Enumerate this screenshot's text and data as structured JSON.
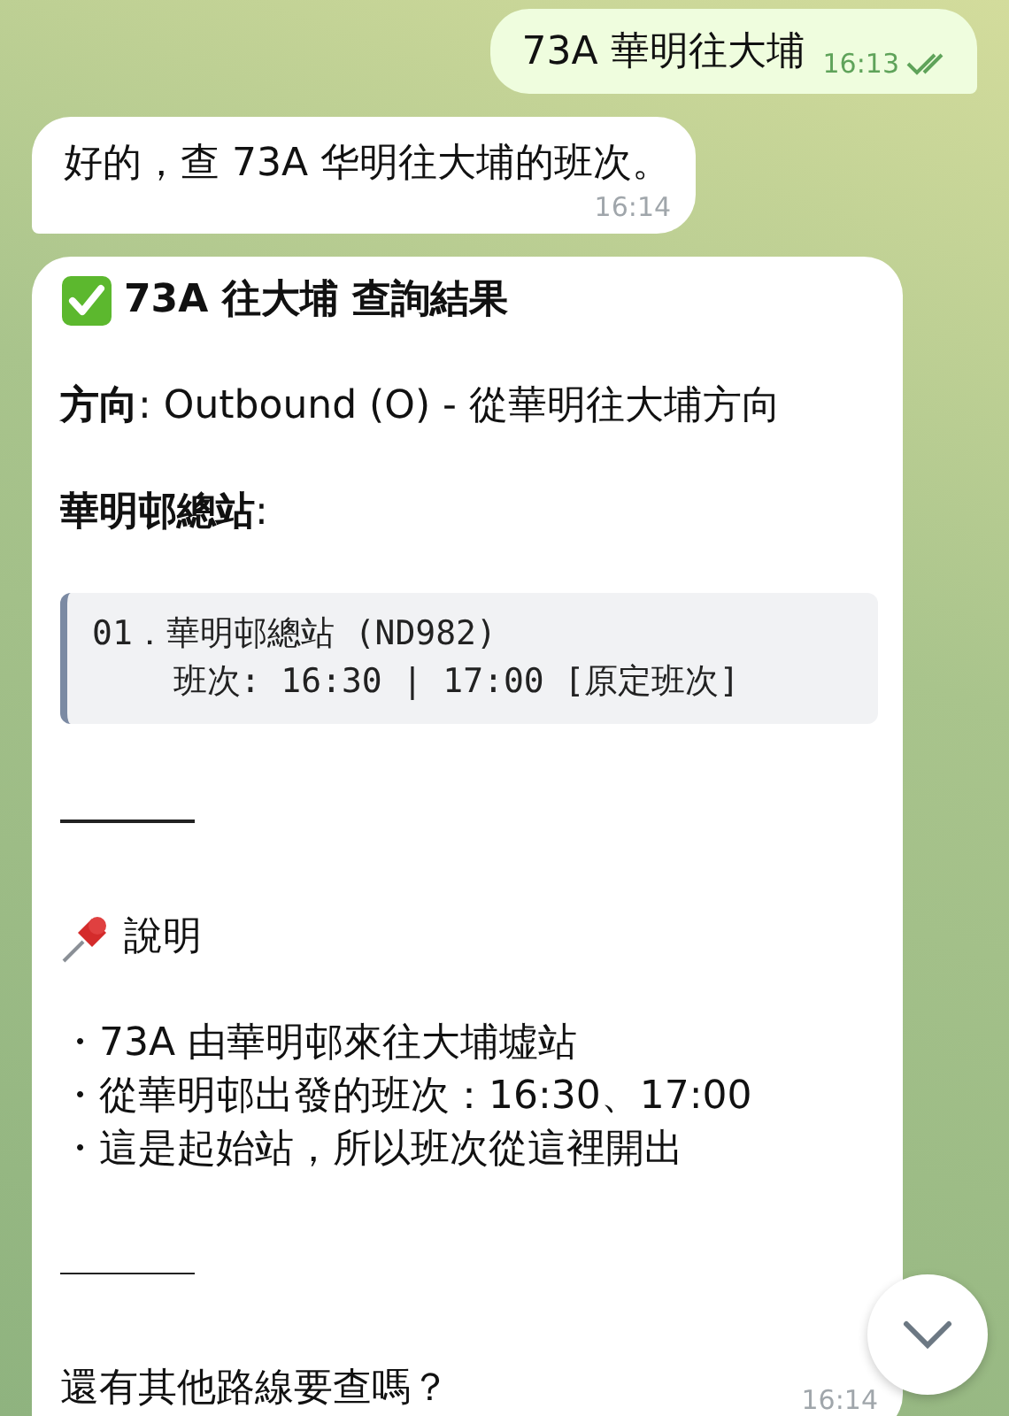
{
  "messages": [
    {
      "kind": "outgoing",
      "text": "73A 華明往大埔",
      "time": "16:13",
      "read": true
    },
    {
      "kind": "incoming",
      "text": "好的，查 73A 华明往大埔的班次。",
      "time": "16:14"
    },
    {
      "kind": "rich",
      "time": "16:14",
      "blocks": [
        {
          "kind": "title",
          "text": "73A 往大埔 查詢結果"
        },
        {
          "kind": "paragraph",
          "text": "**方向**: Outbound (O) - 從華明往大埔方向"
        },
        {
          "kind": "paragraph",
          "text": "**華明邨總站**:"
        },
        {
          "kind": "code",
          "lines": [
            "01．華明邨總站 (ND982)",
            "    班次: 16:30 | 17:00 [原定班次]"
          ]
        },
        {
          "kind": "rule"
        },
        {
          "kind": "section",
          "text": "說明"
        },
        {
          "kind": "bullets",
          "items": [
            "・73A 由華明邨來往大埔墟站",
            "・從華明邨出發的班次：16:30、17:00",
            "・這是起始站，所以班次從這裡開出"
          ]
        },
        {
          "kind": "rule"
        },
        {
          "kind": "paragraph",
          "text": "還有其他路線要查嗎？"
        }
      ]
    }
  ]
}
